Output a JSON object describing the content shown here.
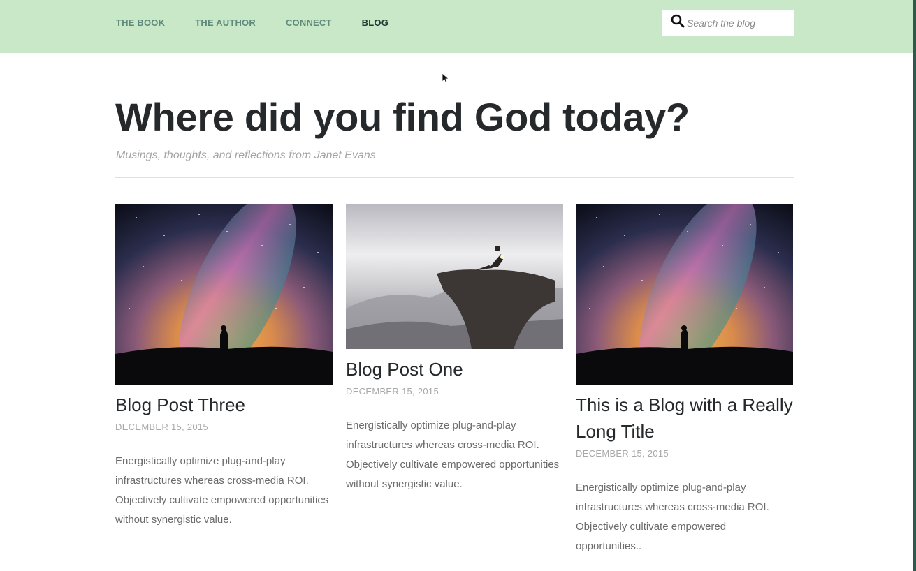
{
  "nav": {
    "items": [
      {
        "label": "THE BOOK"
      },
      {
        "label": "THE AUTHOR"
      },
      {
        "label": "CONNECT"
      },
      {
        "label": "BLOG"
      }
    ]
  },
  "search": {
    "placeholder": "Search the blog",
    "icon": "search-icon"
  },
  "header": {
    "title": "Where did you find God today?",
    "tagline": "Musings, thoughts, and reflections from Janet Evans"
  },
  "posts": [
    {
      "title": "Blog Post Three",
      "date": "DECEMBER 15, 2015",
      "excerpt": "Energistically optimize plug-and-play infrastructures whereas cross-media ROI. Objectively cultivate empowered opportunities without synergistic value.",
      "image": "milky-way-silhouette"
    },
    {
      "title": "Blog Post One",
      "date": "DECEMBER 15, 2015",
      "excerpt": "Energistically optimize plug-and-play infrastructures whereas cross-media ROI. Objectively cultivate empowered opportunities without synergistic value.",
      "image": "person-on-cliff"
    },
    {
      "title": "This is a Blog with a Really Long Title",
      "date": "DECEMBER 15, 2015",
      "excerpt": "Energistically optimize plug-and-play infrastructures whereas cross-media ROI. Objectively cultivate empowered opportunities..",
      "image": "milky-way-silhouette"
    }
  ],
  "colors": {
    "topbar": "#c9e8c8",
    "nav_text": "#5f8a7b",
    "nav_active": "#1f3a33",
    "heading": "#25292b",
    "muted": "#a8a8a8"
  }
}
